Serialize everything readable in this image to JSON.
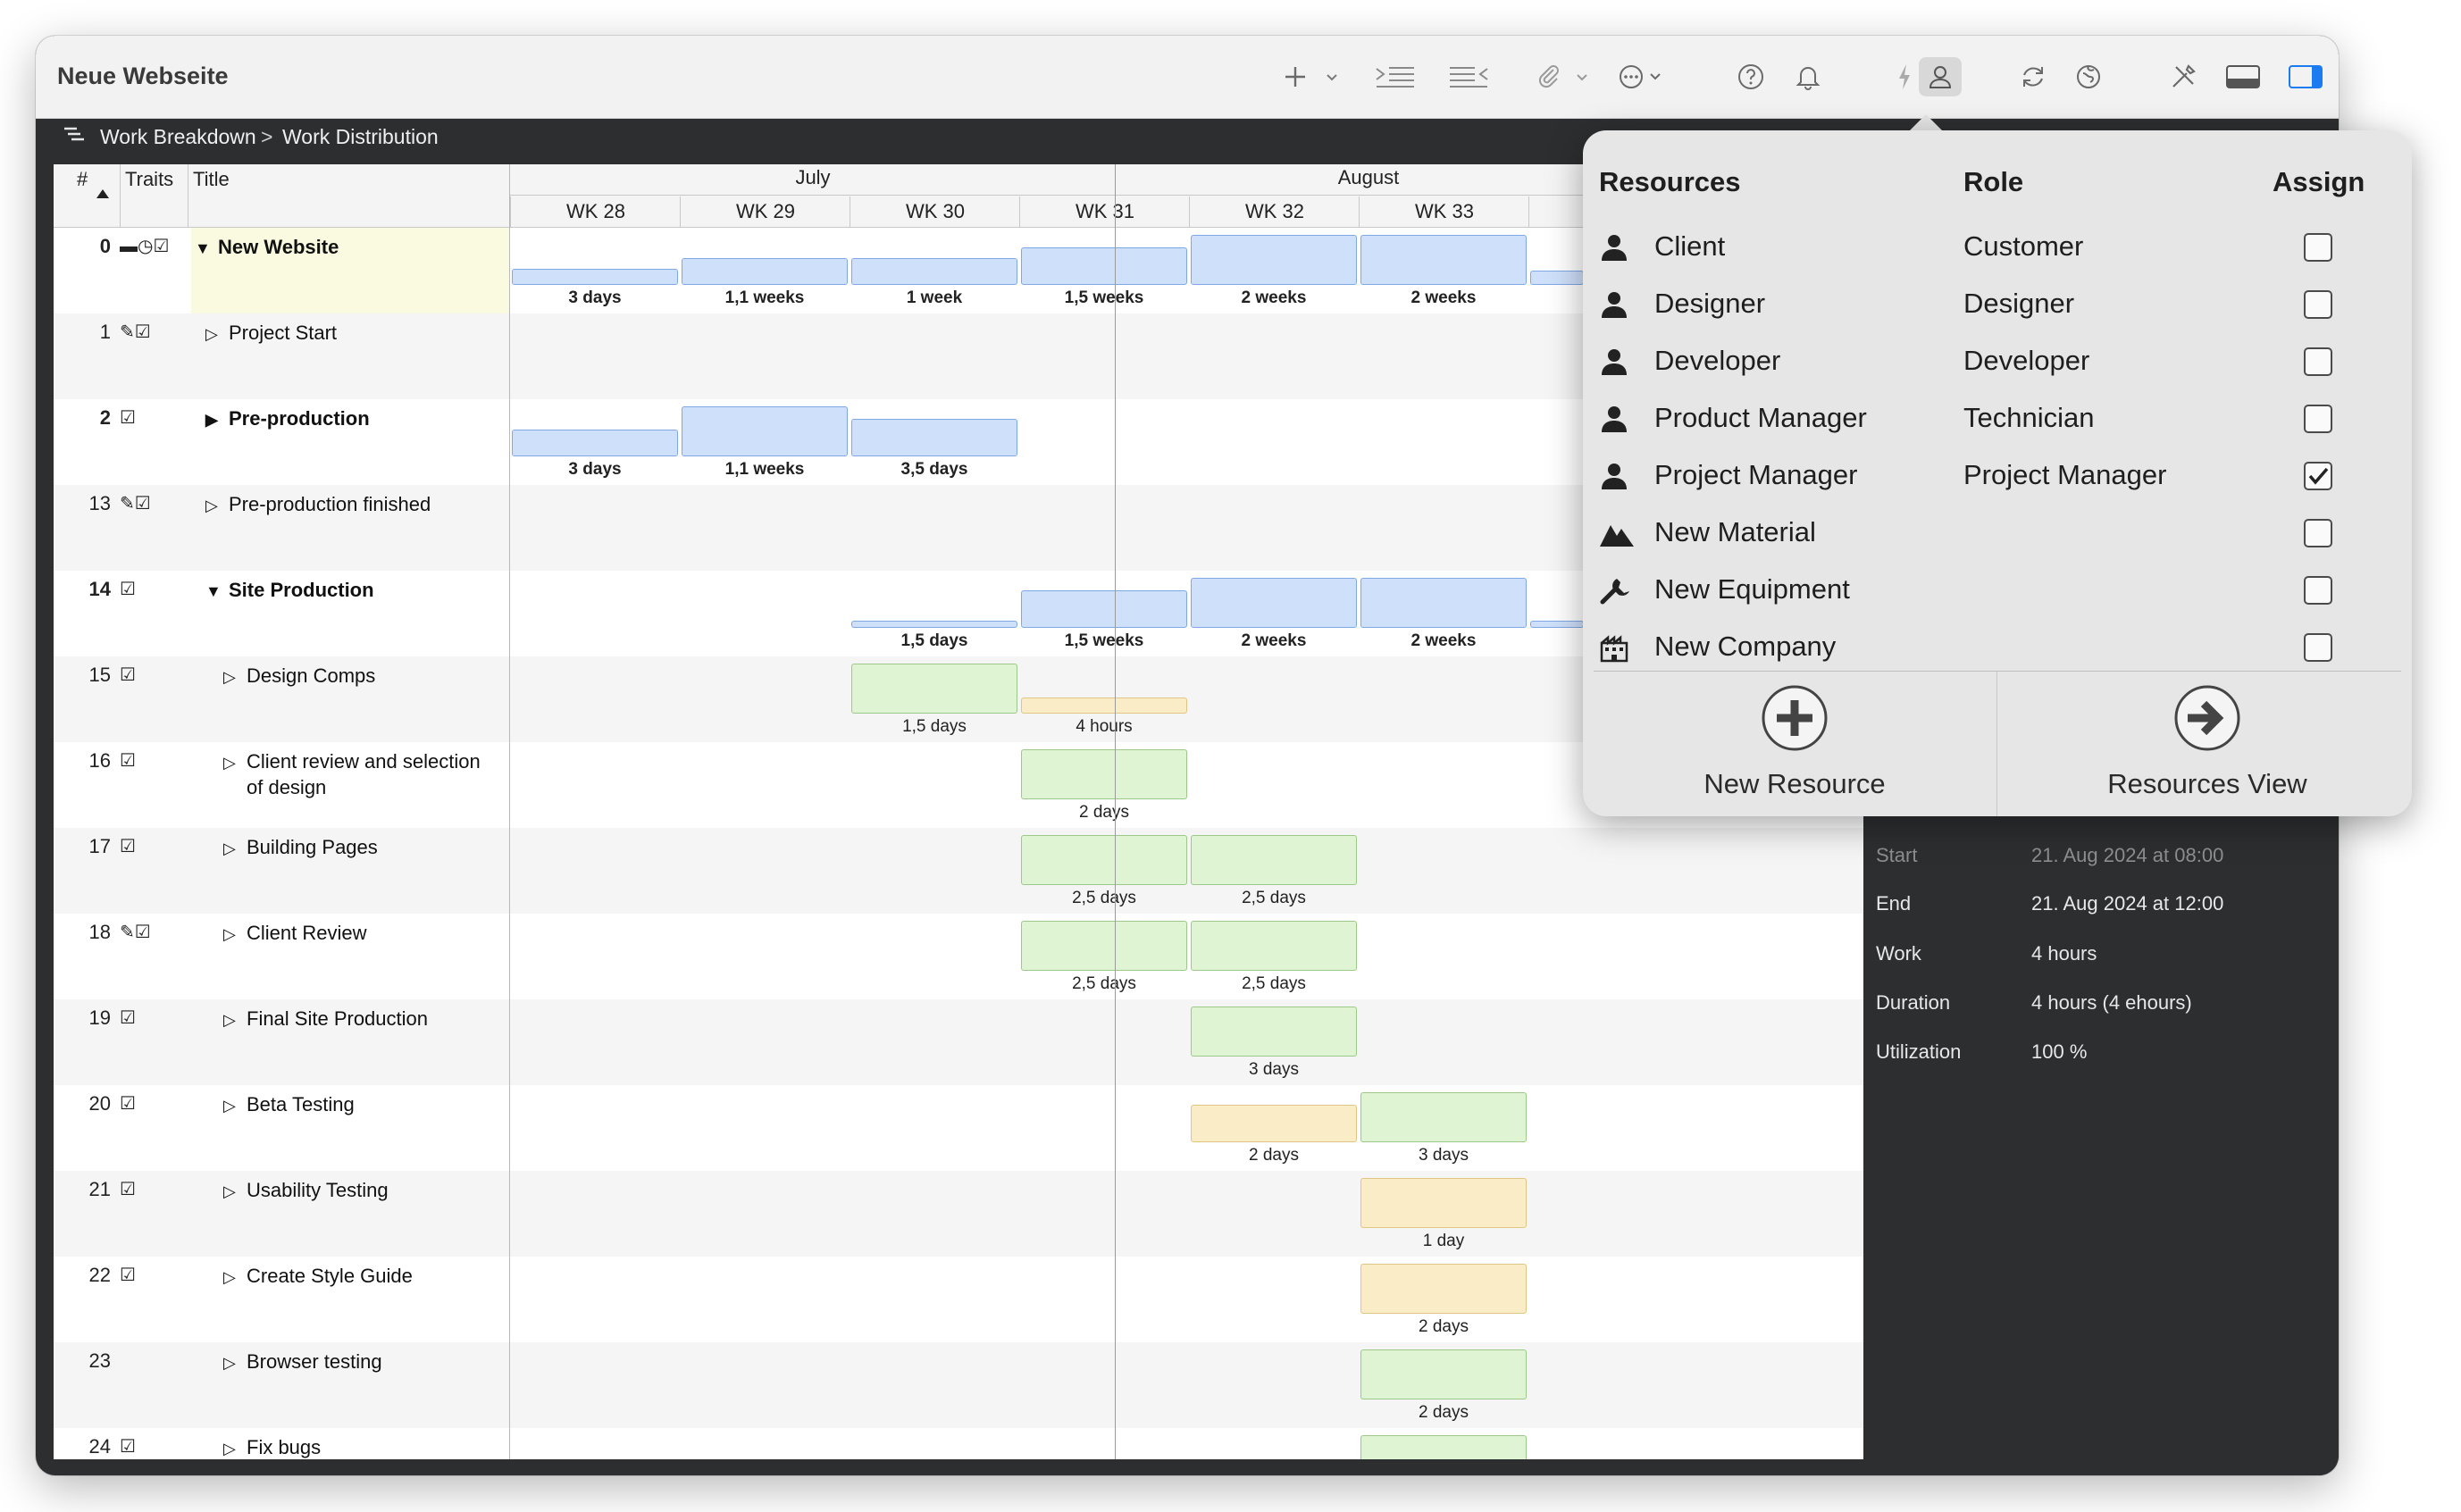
{
  "window_title": "Neue Webseite",
  "breadcrumb": {
    "first": "Work Breakdown",
    "separator": ">",
    "second": "Work Distribution"
  },
  "grid_header": {
    "num": "#",
    "traits": "Traits",
    "title": "Title"
  },
  "months": [
    "July",
    "August"
  ],
  "weeks": [
    "WK 28",
    "WK 29",
    "WK 30",
    "WK 31",
    "WK 32",
    "WK 33"
  ],
  "rows": [
    {
      "num": "0",
      "title": "New Website",
      "bold": true,
      "expanded": true,
      "traits": "▬◷☑",
      "bars": [
        {
          "week": 0,
          "level": "low",
          "color": "blue",
          "label": "3 days"
        },
        {
          "week": 1,
          "level": "mid",
          "color": "blue",
          "label": "1,1 weeks"
        },
        {
          "week": 2,
          "level": "mid",
          "color": "blue",
          "label": "1 week"
        },
        {
          "week": 3,
          "level": "high",
          "color": "blue",
          "label": "1,5 weeks"
        },
        {
          "week": 4,
          "level": "full",
          "color": "blue",
          "label": "2 weeks"
        },
        {
          "week": 5,
          "level": "full",
          "color": "blue",
          "label": "2 weeks"
        }
      ]
    },
    {
      "num": "1",
      "title": "Project Start",
      "traits": "✎☑",
      "bars": []
    },
    {
      "num": "2",
      "title": "Pre-production",
      "bold": true,
      "collapsed_filled": true,
      "traits": "☑",
      "bars": [
        {
          "week": 0,
          "level": "mid",
          "color": "blue",
          "label": "3 days"
        },
        {
          "week": 1,
          "level": "full",
          "color": "blue",
          "label": "1,1 weeks"
        },
        {
          "week": 2,
          "level": "high",
          "color": "blue",
          "label": "3,5 days"
        }
      ]
    },
    {
      "num": "13",
      "title": "Pre-production finished",
      "traits": "✎☑",
      "bars": []
    },
    {
      "num": "14",
      "title": "Site Production",
      "bold": true,
      "expanded": true,
      "traits": "☑",
      "bars": [
        {
          "week": 2,
          "level": "thin",
          "color": "blue",
          "label": "1,5 days"
        },
        {
          "week": 3,
          "level": "high",
          "color": "blue",
          "label": "1,5 weeks"
        },
        {
          "week": 4,
          "level": "full",
          "color": "blue",
          "label": "2 weeks"
        },
        {
          "week": 5,
          "level": "full",
          "color": "blue",
          "label": "2 weeks"
        }
      ]
    },
    {
      "num": "15",
      "title": "Design Comps",
      "indent": 2,
      "traits": "☑",
      "bars": [
        {
          "week": 2,
          "level": "full",
          "color": "green",
          "label": "1,5 days"
        },
        {
          "week": 3,
          "level": "low",
          "color": "yellow",
          "label": "4 hours"
        }
      ]
    },
    {
      "num": "16",
      "title": "Client review and selection",
      "title2": "of design",
      "indent": 2,
      "traits": "☑",
      "bars": [
        {
          "week": 3,
          "level": "full",
          "color": "green",
          "label": "2 days"
        }
      ]
    },
    {
      "num": "17",
      "title": "Building Pages",
      "indent": 2,
      "traits": "☑",
      "bars": [
        {
          "week": 3,
          "level": "full",
          "color": "green",
          "label": "2,5 days"
        },
        {
          "week": 4,
          "level": "full",
          "color": "green",
          "label": "2,5 days"
        }
      ]
    },
    {
      "num": "18",
      "title": "Client Review",
      "indent": 2,
      "traits": "✎☑",
      "bars": [
        {
          "week": 3,
          "level": "full",
          "color": "green",
          "label": "2,5 days"
        },
        {
          "week": 4,
          "level": "full",
          "color": "green",
          "label": "2,5 days"
        }
      ]
    },
    {
      "num": "19",
      "title": "Final Site Production",
      "indent": 2,
      "traits": "☑",
      "bars": [
        {
          "week": 4,
          "level": "full",
          "color": "green",
          "label": "3 days"
        }
      ]
    },
    {
      "num": "20",
      "title": "Beta Testing",
      "indent": 2,
      "traits": "☑",
      "bars": [
        {
          "week": 4,
          "level": "high",
          "color": "yellow",
          "label": "2 days"
        },
        {
          "week": 5,
          "level": "full",
          "color": "green",
          "label": "3 days"
        }
      ]
    },
    {
      "num": "21",
      "title": "Usability Testing",
      "indent": 2,
      "traits": "☑",
      "bars": [
        {
          "week": 5,
          "level": "full",
          "color": "yellow",
          "label": "1 day"
        }
      ]
    },
    {
      "num": "22",
      "title": "Create Style Guide",
      "indent": 2,
      "traits": "☑",
      "bars": [
        {
          "week": 5,
          "level": "full",
          "color": "yellow",
          "label": "2 days"
        }
      ]
    },
    {
      "num": "23",
      "title": "Browser testing",
      "indent": 2,
      "traits": "",
      "bars": [
        {
          "week": 5,
          "level": "full",
          "color": "green",
          "label": "2 days"
        }
      ]
    },
    {
      "num": "24",
      "title": "Fix bugs",
      "indent": 2,
      "traits": "☑",
      "bars": [
        {
          "week": 5,
          "level": "full",
          "color": "green",
          "label": ""
        }
      ]
    }
  ],
  "inspector": {
    "start_label": "Start",
    "start_value": "21. Aug 2024 at 08:00",
    "end_label": "End",
    "end_value": "21. Aug 2024 at 12:00",
    "work_label": "Work",
    "work_value": "4 hours",
    "duration_label": "Duration",
    "duration_value": "4 hours (4 ehours)",
    "utilization_label": "Utilization",
    "utilization_value": "100 %"
  },
  "popover": {
    "col_resources": "Resources",
    "col_role": "Role",
    "col_assign": "Assign",
    "items": [
      {
        "icon": "person",
        "name": "Client",
        "role": "Customer",
        "assigned": false
      },
      {
        "icon": "person",
        "name": "Designer",
        "role": "Designer",
        "assigned": false
      },
      {
        "icon": "person",
        "name": "Developer",
        "role": "Developer",
        "assigned": false
      },
      {
        "icon": "person",
        "name": "Product Manager",
        "role": "Technician",
        "assigned": false
      },
      {
        "icon": "person",
        "name": "Project Manager",
        "role": "Project Manager",
        "assigned": true
      },
      {
        "icon": "material",
        "name": "New Material",
        "role": "",
        "assigned": false
      },
      {
        "icon": "equipment",
        "name": "New Equipment",
        "role": "",
        "assigned": false
      },
      {
        "icon": "company",
        "name": "New Company",
        "role": "",
        "assigned": false
      }
    ],
    "new_resource_label": "New Resource",
    "resources_view_label": "Resources View"
  },
  "colors": {
    "bar_blue": "#cfe0fb",
    "bar_green": "#dff4d2",
    "bar_yellow": "#fbecc8",
    "selection_row": "#fafae0"
  }
}
